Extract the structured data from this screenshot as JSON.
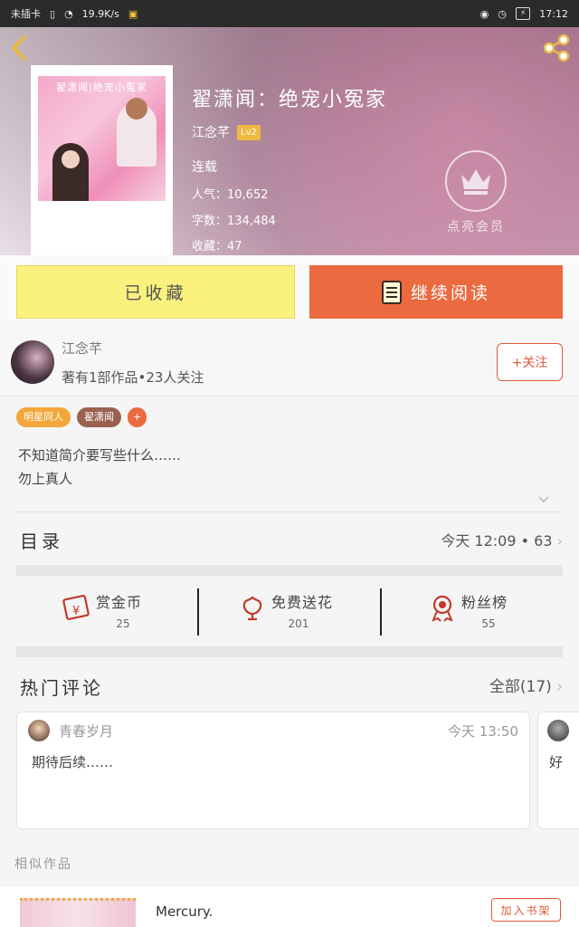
{
  "status_bar": {
    "carrier": "未插卡",
    "speed": "19.9K/s",
    "time": "17:12"
  },
  "book": {
    "cover_title": "翟潇闻|绝宠小冤家",
    "title": "翟潇闻：绝宠小冤家",
    "author": "江念芊",
    "author_level": "Lv2",
    "status": "连载",
    "popularity": "人气：10,652",
    "word_count": "字数：134,484",
    "favorites": "收藏：47",
    "vip_label": "点亮会员"
  },
  "actions": {
    "collected_label": "已收藏",
    "read_label": "继续阅读"
  },
  "author_section": {
    "name": "江念芊",
    "works": "著有1部作品•23人关注",
    "follow_label": "+关注"
  },
  "tags": [
    "明星同人",
    "翟潇闻",
    "+"
  ],
  "intro": {
    "line1": "不知道简介要写些什么……",
    "line2": "勿上真人"
  },
  "toc": {
    "title": "目录",
    "meta": "今天 12:09 • 63"
  },
  "stats": [
    {
      "label": "赏金币",
      "value": "25"
    },
    {
      "label": "免费送花",
      "value": "201"
    },
    {
      "label": "粉丝榜",
      "value": "55"
    }
  ],
  "hot_comments": {
    "title": "热门评论",
    "all_label": "全部(17)",
    "comments": [
      {
        "user": "青春岁月",
        "time": "今天 13:50",
        "text": "期待后续……"
      },
      {
        "text": "好"
      }
    ]
  },
  "similar": {
    "label": "相似作品",
    "items": [
      {
        "name": "Mercury.",
        "action": "加入书架"
      }
    ]
  },
  "colors": {
    "accent_orange": "#ec6a3f",
    "collected_yellow": "#fbf27d",
    "level_gold": "#f0b93f"
  }
}
